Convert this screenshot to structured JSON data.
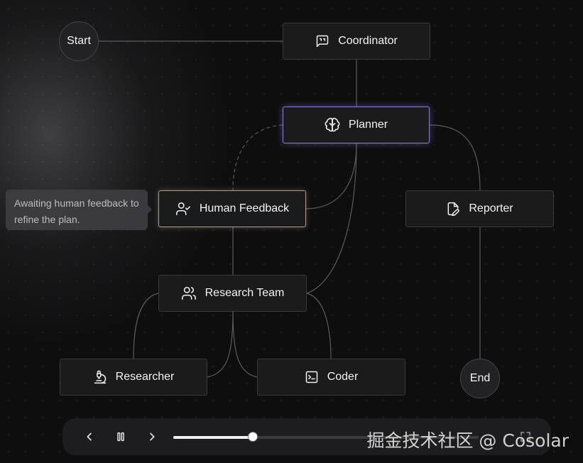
{
  "nodes": {
    "start": "Start",
    "coordinator": "Coordinator",
    "planner": "Planner",
    "human_feedback": "Human Feedback",
    "reporter": "Reporter",
    "research_team": "Research Team",
    "researcher": "Researcher",
    "coder": "Coder",
    "end": "End"
  },
  "tooltip": {
    "text": "Awaiting human feedback to refine the plan."
  },
  "player": {
    "progress": 0.26
  },
  "watermark": "掘金技术社区 @ Cosolar",
  "icons": [
    "message-square-quote-icon",
    "brain-icon",
    "user-check-icon",
    "file-pen-icon",
    "users-icon",
    "microscope-icon",
    "terminal-icon",
    "chevron-left-icon",
    "pause-icon",
    "chevron-right-icon",
    "fullscreen-icon"
  ],
  "colors": {
    "planner_border": "#8b7fd1",
    "feedback_border": "#b39a8a"
  }
}
